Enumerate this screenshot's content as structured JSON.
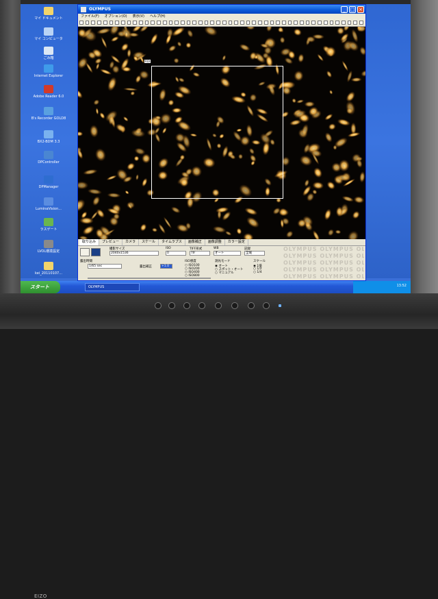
{
  "desktop": {
    "icons": [
      {
        "label": "マイ ドキュメント",
        "color": "#f2d46a"
      },
      {
        "label": "マイ コンピュータ",
        "color": "#b9d3f5"
      },
      {
        "label": "ごみ箱",
        "color": "#dbe7f5"
      },
      {
        "label": "Internet Explorer",
        "color": "#3f9bea"
      },
      {
        "label": "Adobe Reader 6.0",
        "color": "#d23a2a"
      },
      {
        "label": "B's Recorder GOLD8",
        "color": "#5aa0e0"
      },
      {
        "label": "BX2-BDM 3.3",
        "color": "#7ab2ef"
      },
      {
        "label": "DPController",
        "color": "#4a86d2"
      },
      {
        "label": "DPManager",
        "color": "#2e6dd0"
      },
      {
        "label": "LuminaVision...",
        "color": "#5b8de0"
      },
      {
        "label": "ラスゲート",
        "color": "#6ab64f"
      },
      {
        "label": "LVOL環境設定",
        "color": "#8a8a8a"
      },
      {
        "label": "kei_20110107...",
        "color": "#f2d46a"
      }
    ]
  },
  "window": {
    "title": "OLYMPUS",
    "menu": [
      "ファイル(F)",
      "オプション(O)",
      "表示(V)",
      "ヘルプ(H)"
    ],
    "roi_tag": "ROI"
  },
  "panel": {
    "tabs": [
      "取り込み",
      "プレビュー",
      "カメラ",
      "スケール",
      "タイムラプス",
      "画像補正",
      "画像調整",
      "カラー設定"
    ],
    "labels": {
      "mode": "撮影サイズ",
      "mode_value": "2040x1536",
      "exposure_group": "露出時間",
      "exposure_value": "1/65 sec",
      "exposure_comp": "露出補正",
      "exposure_comp_value": "+1.0",
      "iso_label": "ISO",
      "iso_value": "0",
      "jpeg_label": "TIFF形式",
      "jpeg_value": "TIF",
      "wb_label": "WB",
      "wb_value": "オート",
      "recording_label": "記録",
      "recording_value": "全域",
      "sensitivity_label": "ISO感度",
      "iso_options": [
        "ISO100",
        "ISO200",
        "ISO400",
        "ISO800"
      ],
      "metering_label": "測光モード",
      "metering_options": [
        "オート",
        "スポット・オート",
        "マニュアル"
      ],
      "scale_label": "スケール",
      "scale_options": [
        "1倍",
        "1/2",
        "1/4"
      ]
    },
    "watermark": "OLYMPUS OLYMPUS OLYMPUS"
  },
  "taskbar": {
    "start_label": "スタート",
    "task_item": "OLYMPUS",
    "clock": "13:52"
  },
  "monitor": {
    "brand": "EIZO"
  },
  "colors": {
    "titlebar": "#0a58d8",
    "desktop": "#3b74e0",
    "start_button": "#3d9e3d",
    "fluorescence": "#f0b24a"
  }
}
